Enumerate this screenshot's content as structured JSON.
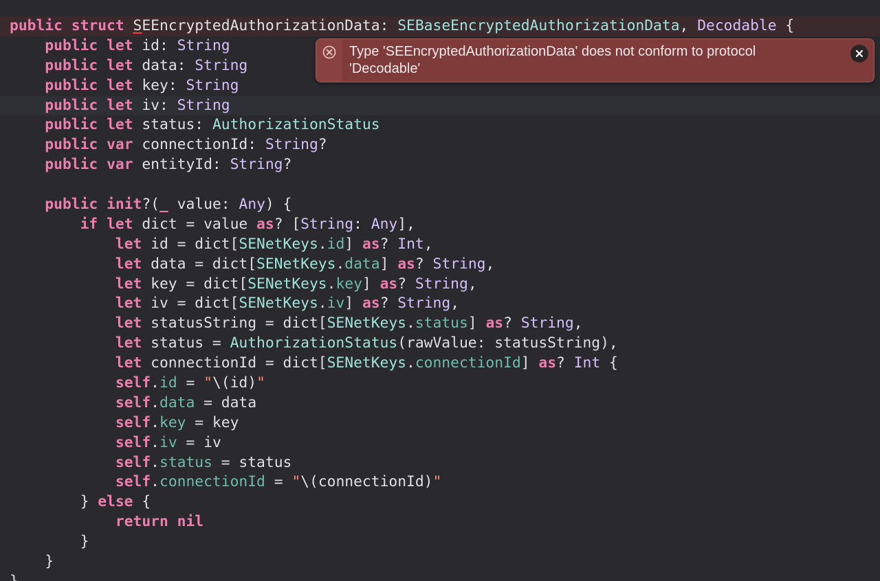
{
  "editor": {
    "lines": [
      {
        "kind": "error",
        "tokens": [
          {
            "t": "public",
            "c": "kw"
          },
          {
            "t": " ",
            "c": "plain"
          },
          {
            "t": "struct",
            "c": "kw"
          },
          {
            "t": " ",
            "c": "plain"
          },
          {
            "t": "S",
            "c": "decl",
            "err": true
          },
          {
            "t": "EEncryptedAuthorizationData",
            "c": "decl"
          },
          {
            "t": ": ",
            "c": "plain"
          },
          {
            "t": "SEBaseEncryptedAuthorizationData",
            "c": "proj"
          },
          {
            "t": ", ",
            "c": "plain"
          },
          {
            "t": "Decodable",
            "c": "type"
          },
          {
            "t": " {",
            "c": "plain"
          }
        ]
      },
      {
        "tokens": [
          {
            "t": "    ",
            "c": "plain"
          },
          {
            "t": "public",
            "c": "kw"
          },
          {
            "t": " ",
            "c": "plain"
          },
          {
            "t": "let",
            "c": "kw"
          },
          {
            "t": " id: ",
            "c": "plain"
          },
          {
            "t": "String",
            "c": "type"
          }
        ]
      },
      {
        "tokens": [
          {
            "t": "    ",
            "c": "plain"
          },
          {
            "t": "public",
            "c": "kw"
          },
          {
            "t": " ",
            "c": "plain"
          },
          {
            "t": "let",
            "c": "kw"
          },
          {
            "t": " data: ",
            "c": "plain"
          },
          {
            "t": "String",
            "c": "type"
          }
        ]
      },
      {
        "tokens": [
          {
            "t": "    ",
            "c": "plain"
          },
          {
            "t": "public",
            "c": "kw"
          },
          {
            "t": " ",
            "c": "plain"
          },
          {
            "t": "let",
            "c": "kw"
          },
          {
            "t": " key: ",
            "c": "plain"
          },
          {
            "t": "String",
            "c": "type"
          }
        ]
      },
      {
        "kind": "current",
        "tokens": [
          {
            "t": "    ",
            "c": "plain"
          },
          {
            "t": "public",
            "c": "kw"
          },
          {
            "t": " ",
            "c": "plain"
          },
          {
            "t": "let",
            "c": "kw"
          },
          {
            "t": " iv: ",
            "c": "plain"
          },
          {
            "t": "String",
            "c": "type"
          }
        ]
      },
      {
        "tokens": [
          {
            "t": "    ",
            "c": "plain"
          },
          {
            "t": "public",
            "c": "kw"
          },
          {
            "t": " ",
            "c": "plain"
          },
          {
            "t": "let",
            "c": "kw"
          },
          {
            "t": " status: ",
            "c": "plain"
          },
          {
            "t": "AuthorizationStatus",
            "c": "proj"
          }
        ]
      },
      {
        "tokens": [
          {
            "t": "    ",
            "c": "plain"
          },
          {
            "t": "public",
            "c": "kw"
          },
          {
            "t": " ",
            "c": "plain"
          },
          {
            "t": "var",
            "c": "kw"
          },
          {
            "t": " connectionId: ",
            "c": "plain"
          },
          {
            "t": "String",
            "c": "type"
          },
          {
            "t": "?",
            "c": "plain"
          }
        ]
      },
      {
        "tokens": [
          {
            "t": "    ",
            "c": "plain"
          },
          {
            "t": "public",
            "c": "kw"
          },
          {
            "t": " ",
            "c": "plain"
          },
          {
            "t": "var",
            "c": "kw"
          },
          {
            "t": " entityId: ",
            "c": "plain"
          },
          {
            "t": "String",
            "c": "type"
          },
          {
            "t": "?",
            "c": "plain"
          }
        ]
      },
      {
        "tokens": []
      },
      {
        "tokens": [
          {
            "t": "    ",
            "c": "plain"
          },
          {
            "t": "public",
            "c": "kw"
          },
          {
            "t": " ",
            "c": "plain"
          },
          {
            "t": "init",
            "c": "kw"
          },
          {
            "t": "?(",
            "c": "plain"
          },
          {
            "t": "_",
            "c": "kw"
          },
          {
            "t": " value: ",
            "c": "plain"
          },
          {
            "t": "Any",
            "c": "type"
          },
          {
            "t": ") {",
            "c": "plain"
          }
        ]
      },
      {
        "tokens": [
          {
            "t": "        ",
            "c": "plain"
          },
          {
            "t": "if",
            "c": "kw"
          },
          {
            "t": " ",
            "c": "plain"
          },
          {
            "t": "let",
            "c": "kw"
          },
          {
            "t": " dict = value ",
            "c": "plain"
          },
          {
            "t": "as",
            "c": "kw"
          },
          {
            "t": "? [",
            "c": "plain"
          },
          {
            "t": "String",
            "c": "type"
          },
          {
            "t": ": ",
            "c": "plain"
          },
          {
            "t": "Any",
            "c": "type"
          },
          {
            "t": "],",
            "c": "plain"
          }
        ]
      },
      {
        "tokens": [
          {
            "t": "            ",
            "c": "plain"
          },
          {
            "t": "let",
            "c": "kw"
          },
          {
            "t": " id = dict[",
            "c": "plain"
          },
          {
            "t": "SENetKeys",
            "c": "proj"
          },
          {
            "t": ".",
            "c": "plain"
          },
          {
            "t": "id",
            "c": "prop"
          },
          {
            "t": "] ",
            "c": "plain"
          },
          {
            "t": "as",
            "c": "kw"
          },
          {
            "t": "? ",
            "c": "plain"
          },
          {
            "t": "Int",
            "c": "type"
          },
          {
            "t": ",",
            "c": "plain"
          }
        ]
      },
      {
        "tokens": [
          {
            "t": "            ",
            "c": "plain"
          },
          {
            "t": "let",
            "c": "kw"
          },
          {
            "t": " data = dict[",
            "c": "plain"
          },
          {
            "t": "SENetKeys",
            "c": "proj"
          },
          {
            "t": ".",
            "c": "plain"
          },
          {
            "t": "data",
            "c": "prop"
          },
          {
            "t": "] ",
            "c": "plain"
          },
          {
            "t": "as",
            "c": "kw"
          },
          {
            "t": "? ",
            "c": "plain"
          },
          {
            "t": "String",
            "c": "type"
          },
          {
            "t": ",",
            "c": "plain"
          }
        ]
      },
      {
        "tokens": [
          {
            "t": "            ",
            "c": "plain"
          },
          {
            "t": "let",
            "c": "kw"
          },
          {
            "t": " key = dict[",
            "c": "plain"
          },
          {
            "t": "SENetKeys",
            "c": "proj"
          },
          {
            "t": ".",
            "c": "plain"
          },
          {
            "t": "key",
            "c": "prop"
          },
          {
            "t": "] ",
            "c": "plain"
          },
          {
            "t": "as",
            "c": "kw"
          },
          {
            "t": "? ",
            "c": "plain"
          },
          {
            "t": "String",
            "c": "type"
          },
          {
            "t": ",",
            "c": "plain"
          }
        ]
      },
      {
        "tokens": [
          {
            "t": "            ",
            "c": "plain"
          },
          {
            "t": "let",
            "c": "kw"
          },
          {
            "t": " iv = dict[",
            "c": "plain"
          },
          {
            "t": "SENetKeys",
            "c": "proj"
          },
          {
            "t": ".",
            "c": "plain"
          },
          {
            "t": "iv",
            "c": "prop"
          },
          {
            "t": "] ",
            "c": "plain"
          },
          {
            "t": "as",
            "c": "kw"
          },
          {
            "t": "? ",
            "c": "plain"
          },
          {
            "t": "String",
            "c": "type"
          },
          {
            "t": ",",
            "c": "plain"
          }
        ]
      },
      {
        "tokens": [
          {
            "t": "            ",
            "c": "plain"
          },
          {
            "t": "let",
            "c": "kw"
          },
          {
            "t": " statusString = dict[",
            "c": "plain"
          },
          {
            "t": "SENetKeys",
            "c": "proj"
          },
          {
            "t": ".",
            "c": "plain"
          },
          {
            "t": "status",
            "c": "prop"
          },
          {
            "t": "] ",
            "c": "plain"
          },
          {
            "t": "as",
            "c": "kw"
          },
          {
            "t": "? ",
            "c": "plain"
          },
          {
            "t": "String",
            "c": "type"
          },
          {
            "t": ",",
            "c": "plain"
          }
        ]
      },
      {
        "tokens": [
          {
            "t": "            ",
            "c": "plain"
          },
          {
            "t": "let",
            "c": "kw"
          },
          {
            "t": " status = ",
            "c": "plain"
          },
          {
            "t": "AuthorizationStatus",
            "c": "proj"
          },
          {
            "t": "(rawValue: statusString),",
            "c": "plain"
          }
        ]
      },
      {
        "tokens": [
          {
            "t": "            ",
            "c": "plain"
          },
          {
            "t": "let",
            "c": "kw"
          },
          {
            "t": " connectionId = dict[",
            "c": "plain"
          },
          {
            "t": "SENetKeys",
            "c": "proj"
          },
          {
            "t": ".",
            "c": "plain"
          },
          {
            "t": "connectionId",
            "c": "prop"
          },
          {
            "t": "] ",
            "c": "plain"
          },
          {
            "t": "as",
            "c": "kw"
          },
          {
            "t": "? ",
            "c": "plain"
          },
          {
            "t": "Int",
            "c": "type"
          },
          {
            "t": " {",
            "c": "plain"
          }
        ]
      },
      {
        "tokens": [
          {
            "t": "            ",
            "c": "plain"
          },
          {
            "t": "self",
            "c": "kw"
          },
          {
            "t": ".",
            "c": "plain"
          },
          {
            "t": "id",
            "c": "prop"
          },
          {
            "t": " = ",
            "c": "plain"
          },
          {
            "t": "\"",
            "c": "str"
          },
          {
            "t": "\\(id)",
            "c": "plain"
          },
          {
            "t": "\"",
            "c": "str"
          }
        ]
      },
      {
        "tokens": [
          {
            "t": "            ",
            "c": "plain"
          },
          {
            "t": "self",
            "c": "kw"
          },
          {
            "t": ".",
            "c": "plain"
          },
          {
            "t": "data",
            "c": "prop"
          },
          {
            "t": " = data",
            "c": "plain"
          }
        ]
      },
      {
        "tokens": [
          {
            "t": "            ",
            "c": "plain"
          },
          {
            "t": "self",
            "c": "kw"
          },
          {
            "t": ".",
            "c": "plain"
          },
          {
            "t": "key",
            "c": "prop"
          },
          {
            "t": " = key",
            "c": "plain"
          }
        ]
      },
      {
        "tokens": [
          {
            "t": "            ",
            "c": "plain"
          },
          {
            "t": "self",
            "c": "kw"
          },
          {
            "t": ".",
            "c": "plain"
          },
          {
            "t": "iv",
            "c": "prop"
          },
          {
            "t": " = iv",
            "c": "plain"
          }
        ]
      },
      {
        "tokens": [
          {
            "t": "            ",
            "c": "plain"
          },
          {
            "t": "self",
            "c": "kw"
          },
          {
            "t": ".",
            "c": "plain"
          },
          {
            "t": "status",
            "c": "prop"
          },
          {
            "t": " = status",
            "c": "plain"
          }
        ]
      },
      {
        "tokens": [
          {
            "t": "            ",
            "c": "plain"
          },
          {
            "t": "self",
            "c": "kw"
          },
          {
            "t": ".",
            "c": "plain"
          },
          {
            "t": "connectionId",
            "c": "prop"
          },
          {
            "t": " = ",
            "c": "plain"
          },
          {
            "t": "\"",
            "c": "str"
          },
          {
            "t": "\\(connectionId)",
            "c": "plain"
          },
          {
            "t": "\"",
            "c": "str"
          }
        ]
      },
      {
        "tokens": [
          {
            "t": "        } ",
            "c": "plain"
          },
          {
            "t": "else",
            "c": "kw"
          },
          {
            "t": " {",
            "c": "plain"
          }
        ]
      },
      {
        "tokens": [
          {
            "t": "            ",
            "c": "plain"
          },
          {
            "t": "return",
            "c": "kw"
          },
          {
            "t": " ",
            "c": "plain"
          },
          {
            "t": "nil",
            "c": "kw"
          }
        ]
      },
      {
        "tokens": [
          {
            "t": "        }",
            "c": "plain"
          }
        ]
      },
      {
        "tokens": [
          {
            "t": "    }",
            "c": "plain"
          }
        ]
      },
      {
        "tokens": [
          {
            "t": "}",
            "c": "plain"
          }
        ]
      }
    ]
  },
  "error_banner": {
    "message": "Type 'SEEncryptedAuthorizationData' does not conform to protocol 'Decodable'",
    "icon": "error-circle-x-icon",
    "close_icon": "close-icon"
  },
  "colors": {
    "background": "#2a2a2e",
    "keyword": "#ef7eb0",
    "type": "#d6c0fb",
    "project_type": "#9fe3da",
    "property": "#6ebcae",
    "string": "#ff8a7a",
    "plain": "#e0e0e3",
    "error_banner": "#7e3b3a",
    "error_red": "#ff453a"
  }
}
